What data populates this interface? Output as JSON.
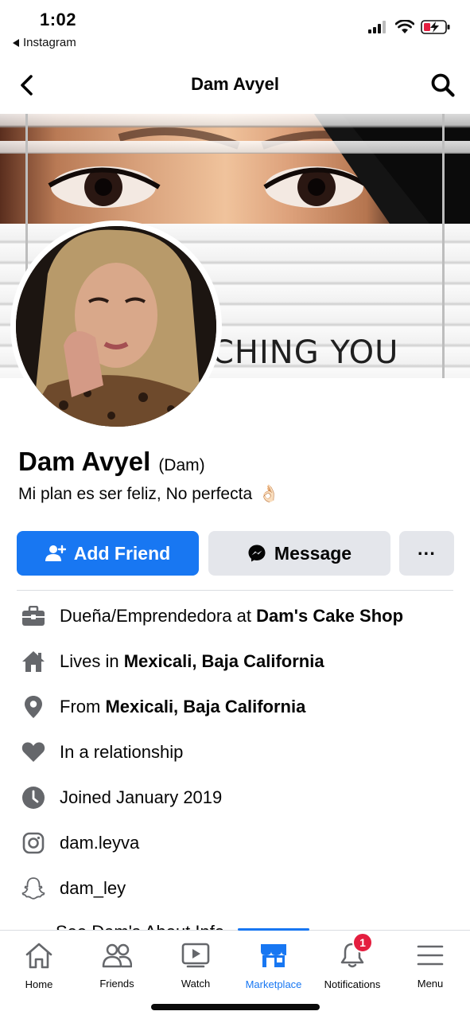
{
  "status_bar": {
    "time": "1:02",
    "back_app": "Instagram"
  },
  "header": {
    "title": "Dam Avyel"
  },
  "cover": {
    "text": "CHING YOU"
  },
  "profile": {
    "name": "Dam Avyel",
    "alt_name": "(Dam)",
    "bio": "Mi plan es ser feliz, No perfecta",
    "bio_emoji": "👌🏻"
  },
  "actions": {
    "add_friend": "Add Friend",
    "message": "Message",
    "more": "···"
  },
  "details": [
    {
      "icon": "briefcase-icon",
      "prefix": "Dueña/Emprendedora at ",
      "bold": "Dam's Cake Shop"
    },
    {
      "icon": "home-icon",
      "prefix": "Lives in ",
      "bold": "Mexicali, Baja California"
    },
    {
      "icon": "location-pin-icon",
      "prefix": "From ",
      "bold": "Mexicali, Baja California"
    },
    {
      "icon": "heart-icon",
      "prefix": "In a relationship",
      "bold": ""
    },
    {
      "icon": "clock-icon",
      "prefix": "Joined January 2019",
      "bold": ""
    },
    {
      "icon": "instagram-icon",
      "prefix": "dam.leyva",
      "bold": ""
    },
    {
      "icon": "snapchat-icon",
      "prefix": "dam_ley",
      "bold": ""
    }
  ],
  "peek_text": "See Dam's About Info",
  "tabs": [
    {
      "label": "Home",
      "icon": "home-tab-icon",
      "active": false
    },
    {
      "label": "Friends",
      "icon": "friends-icon",
      "active": false
    },
    {
      "label": "Watch",
      "icon": "watch-icon",
      "active": false
    },
    {
      "label": "Marketplace",
      "icon": "marketplace-icon",
      "active": true
    },
    {
      "label": "Notifications",
      "icon": "bell-icon",
      "active": false,
      "badge": "1"
    },
    {
      "label": "Menu",
      "icon": "menu-icon",
      "active": false
    }
  ],
  "colors": {
    "accent": "#1877f2",
    "button_gray": "#e4e6eb",
    "badge_red": "#e41e3f"
  }
}
